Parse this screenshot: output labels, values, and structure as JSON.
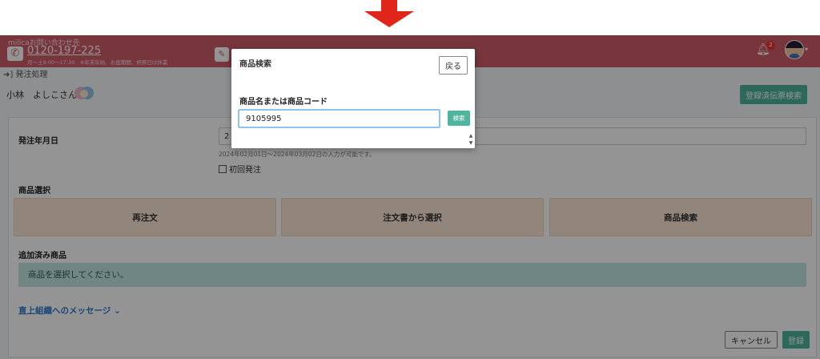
{
  "header": {
    "company": "millcaお問い合わせ先",
    "phone": "0120-197-225",
    "hours": "月〜土9:00〜17:30　※年末年始、お盆期間、祝祭日は休業",
    "notification_count": "2"
  },
  "breadcrumb": "発注処理",
  "user": {
    "name": "小林　よしこさん"
  },
  "buttons": {
    "registered_slips": "登録済伝票検索",
    "cancel": "キャンセル",
    "register": "登録"
  },
  "form": {
    "order_date_label": "発注年月日",
    "order_date_value": "2",
    "date_hint": "2024年02月01日〜2024年03月02日の入力が可能です。",
    "first_order_label": "初回発注",
    "product_select_label": "商品選択",
    "select_options": [
      "再注文",
      "注文書から選択",
      "商品検索"
    ],
    "added_products_label": "追加済み商品",
    "added_products_alert": "商品を選択してください。",
    "message_link": "直上組織へのメッセージ"
  },
  "modal": {
    "title": "商品検索",
    "back_label": "戻る",
    "field_label": "商品名または商品コード",
    "input_value": "9105995",
    "search_label": "検索"
  },
  "colors": {
    "header_bg": "#cd5c68",
    "accent_green": "#4fb59e",
    "arrow_red": "#e1251b",
    "alert_bg": "#bfe7e1",
    "option_bg": "#fbe6d6"
  }
}
